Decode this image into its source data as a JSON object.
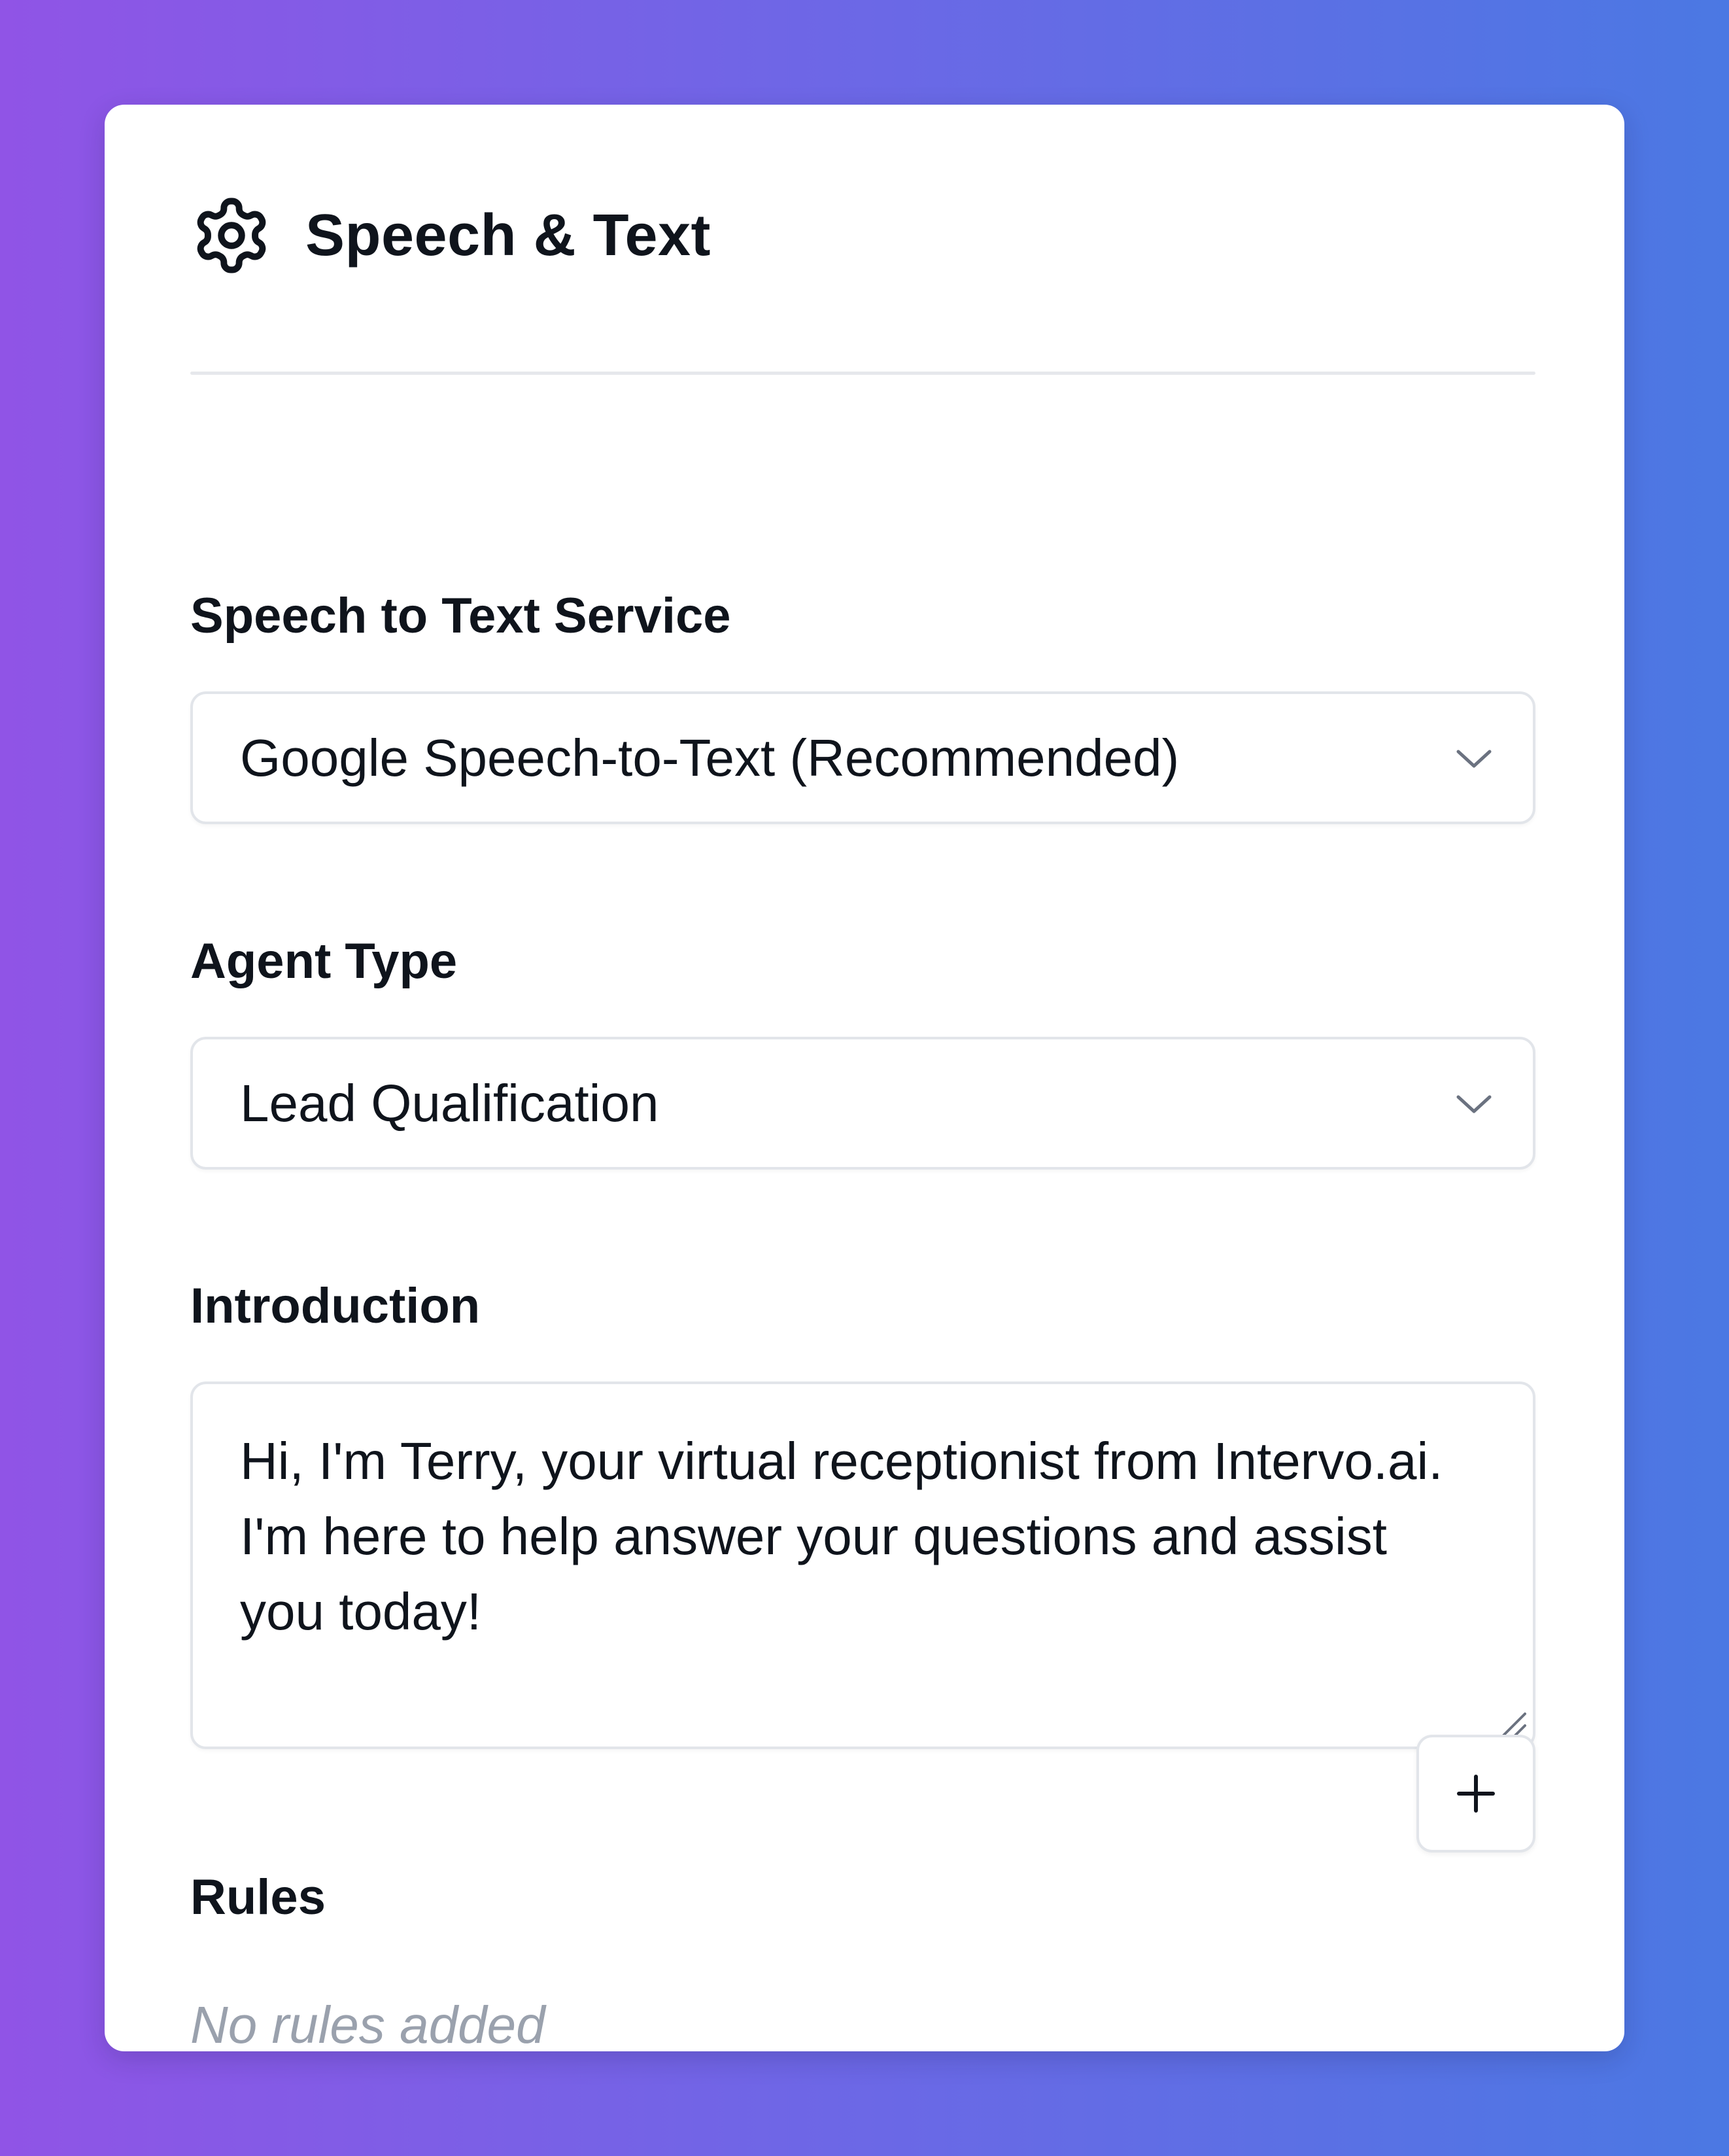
{
  "panel": {
    "title": "Speech & Text",
    "icon": "gear-icon"
  },
  "speech_to_text": {
    "label": "Speech to Text Service",
    "selected": "Google Speech-to-Text (Recommended)"
  },
  "agent_type": {
    "label": "Agent Type",
    "selected": "Lead Qualification"
  },
  "introduction": {
    "label": "Introduction",
    "value": "Hi, I'm Terry, your virtual receptionist from Intervo.ai. I'm here to help answer your questions and assist you today!"
  },
  "rules": {
    "label": "Rules",
    "empty_text": "No rules added",
    "add_icon": "plus-icon"
  },
  "colors": {
    "background_start": "#9054e6",
    "background_end": "#4b78e3",
    "card": "#ffffff",
    "text": "#0f141c",
    "muted_text": "#9aa1ad",
    "border": "#e2e5ea"
  }
}
